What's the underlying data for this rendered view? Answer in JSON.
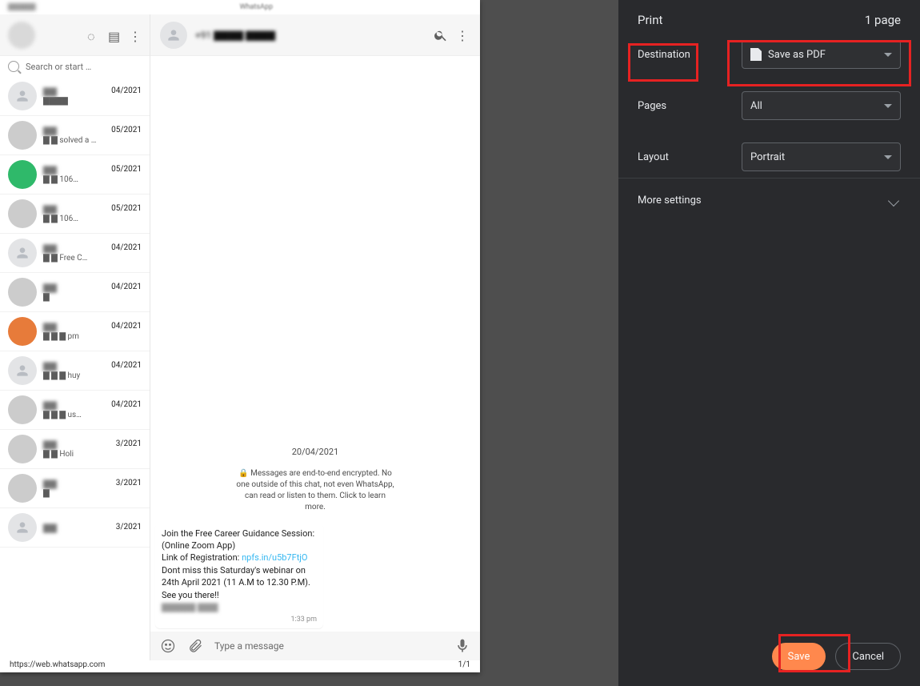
{
  "preview": {
    "footer_left": "https://web.whatsapp.com",
    "footer_right": "1/1",
    "topbar": [
      "",
      "WhatsApp"
    ],
    "left_panel": {
      "search_placeholder": "Search or start …",
      "chats": [
        {
          "name": "▇▇",
          "date": "04/2021",
          "line2": "▇▇▇▇",
          "avatar": "grey"
        },
        {
          "name": "▇▇",
          "date": "05/2021",
          "line2": "▇ ▇ solved a …",
          "avatar": "photo"
        },
        {
          "name": "▇▇",
          "date": "05/2021",
          "line2": "▇ ▇ 106…",
          "avatar": "green"
        },
        {
          "name": "▇▇",
          "date": "05/2021",
          "line2": "▇ ▇ 106…",
          "avatar": "photo"
        },
        {
          "name": "▇▇",
          "date": "04/2021",
          "line2": "▇ ▇ Free C…",
          "avatar": "grey"
        },
        {
          "name": "▇▇",
          "date": "04/2021",
          "line2": "▇",
          "avatar": "photo"
        },
        {
          "name": "▇▇",
          "date": "04/2021",
          "line2": "▇ ▇ ▇ pm",
          "avatar": "orange"
        },
        {
          "name": "▇▇",
          "date": "04/2021",
          "line2": "▇ ▇ ▇ huy",
          "avatar": "grey"
        },
        {
          "name": "▇▇",
          "date": "04/2021",
          "line2": "▇ ▇ ▇ us…",
          "avatar": "photo"
        },
        {
          "name": "▇▇",
          "date": "3/2021",
          "line2": "▇ ▇ Holi",
          "avatar": "photo"
        },
        {
          "name": "▇▇",
          "date": "3/2021",
          "line2": "▇",
          "avatar": "photo"
        },
        {
          "name": "▇▇",
          "date": "3/2021",
          "line2": "",
          "avatar": "grey"
        }
      ]
    },
    "conversation": {
      "header_title": "+91 ▇▇▇▇ ▇▇▇▇",
      "date_chip": "20/04/2021",
      "encryption_notice": "🔒 Messages are end-to-end encrypted. No one outside of this chat, not even WhatsApp, can read or listen to them. Click to learn more.",
      "message": {
        "line1": "Join the Free Career Guidance Session: (Online Zoom App)",
        "link_label": "Link of Registration: ",
        "link_text": "npfs.in/u5b7FtjO",
        "line3": "Dont miss this Saturday's webinar on 24th April 2021 (11 A.M to 12.30 P.M). See you there!!",
        "line4": "▇▇▇▇▇ ▇▇▇",
        "time": "1:33 pm"
      },
      "composer_placeholder": "Type a message"
    }
  },
  "print_dialog": {
    "title": "Print",
    "page_count": "1 page",
    "rows": {
      "destination_label": "Destination",
      "destination_value": "Save as PDF",
      "pages_label": "Pages",
      "pages_value": "All",
      "layout_label": "Layout",
      "layout_value": "Portrait"
    },
    "more_settings": "More settings",
    "save": "Save",
    "cancel": "Cancel"
  }
}
